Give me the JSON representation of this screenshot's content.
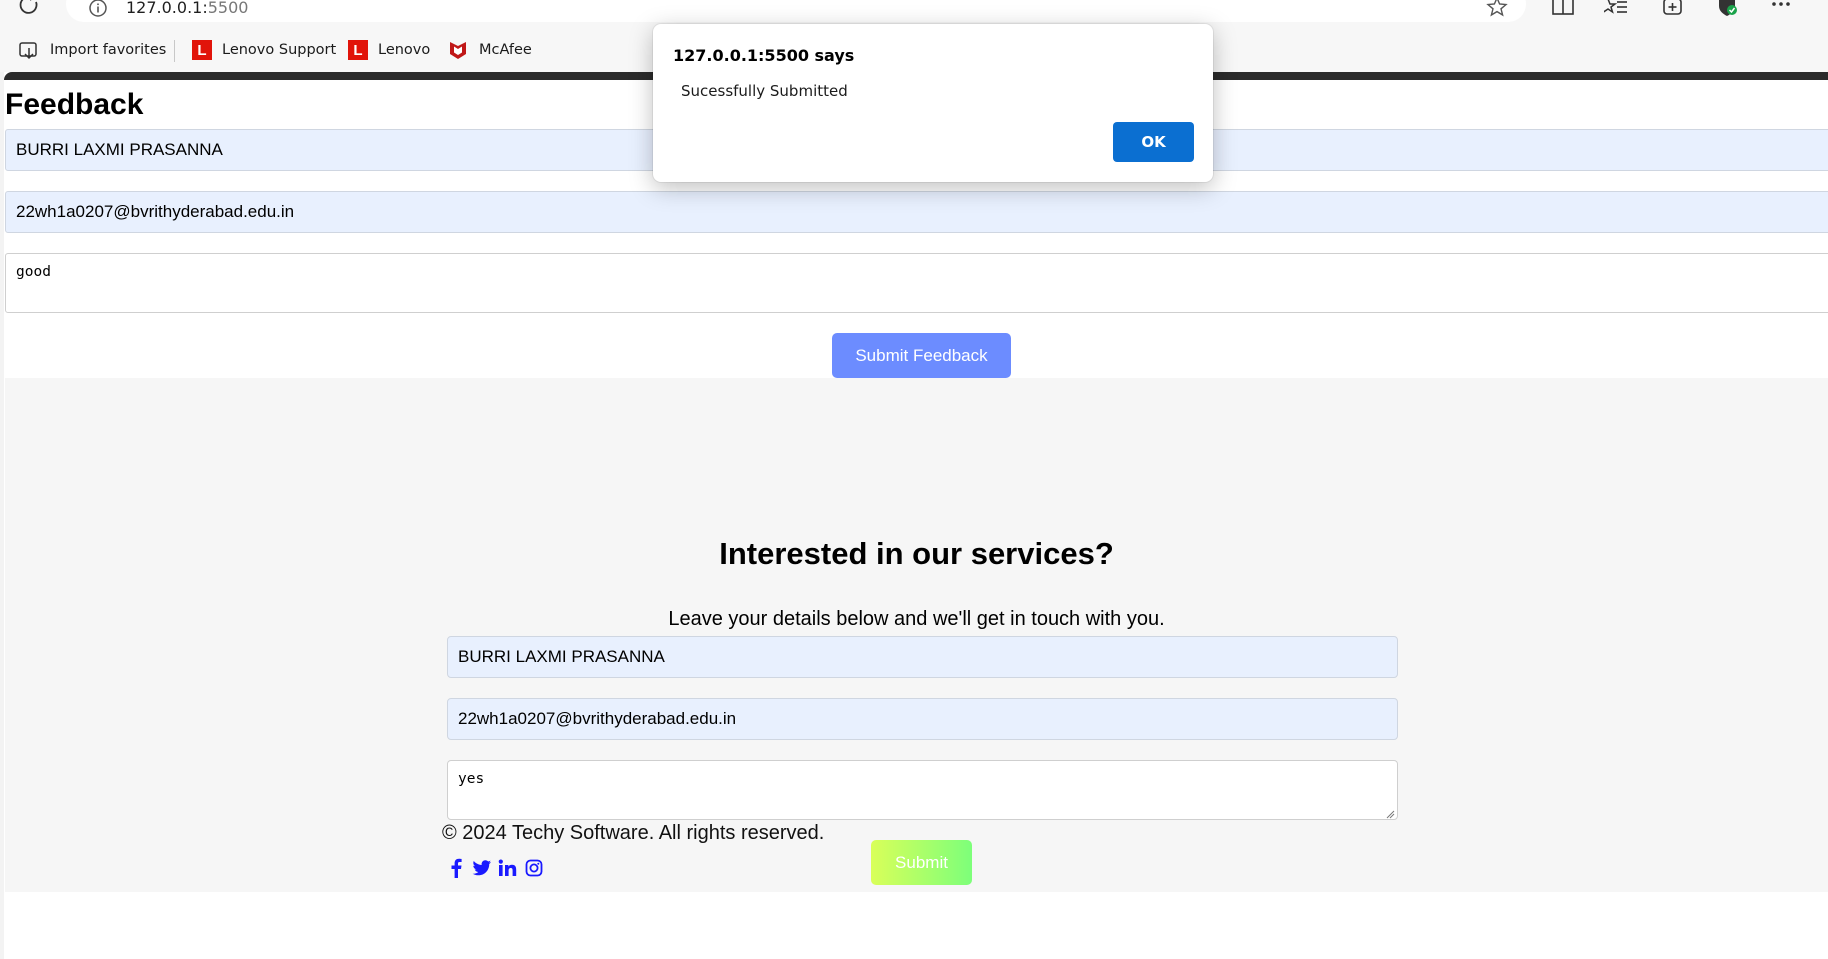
{
  "browser": {
    "url_host": "127.0.0.1:",
    "url_port": "5500",
    "bookmarks": [
      {
        "label": "Import favorites",
        "icon": "import-icon"
      },
      {
        "label": "Lenovo Support",
        "icon": "lenovo-icon"
      },
      {
        "label": "Lenovo",
        "icon": "lenovo-icon"
      },
      {
        "label": "McAfee",
        "icon": "mcafee-icon"
      }
    ]
  },
  "feedback": {
    "title": "Feedback",
    "name_value": "BURRI LAXMI PRASANNA",
    "email_value": "22wh1a0207@bvrithyderabad.edu.in",
    "message_value": "good",
    "submit_label": "Submit Feedback"
  },
  "contact": {
    "heading": "Interested in our services?",
    "lead": "Leave your details below and we'll get in touch with you.",
    "name_value": "BURRI LAXMI PRASANNA",
    "email_value": "22wh1a0207@bvrithyderabad.edu.in",
    "message_value": "yes",
    "submit_label": "Submit"
  },
  "footer": {
    "copyright": "© 2024 Techy Software. All rights reserved.",
    "socials": [
      "facebook-icon",
      "twitter-icon",
      "linkedin-icon",
      "instagram-icon"
    ]
  },
  "dialog": {
    "title": "127.0.0.1:5500 says",
    "message": "Sucessfully Submitted",
    "ok_label": "OK"
  },
  "colors": {
    "feedback_button": "#6c8cff",
    "dialog_ok": "#0b6fd1",
    "submit_gradient_start": "#d9ff59",
    "submit_gradient_end": "#7dff7a",
    "autofill": "#e8f0fe"
  }
}
